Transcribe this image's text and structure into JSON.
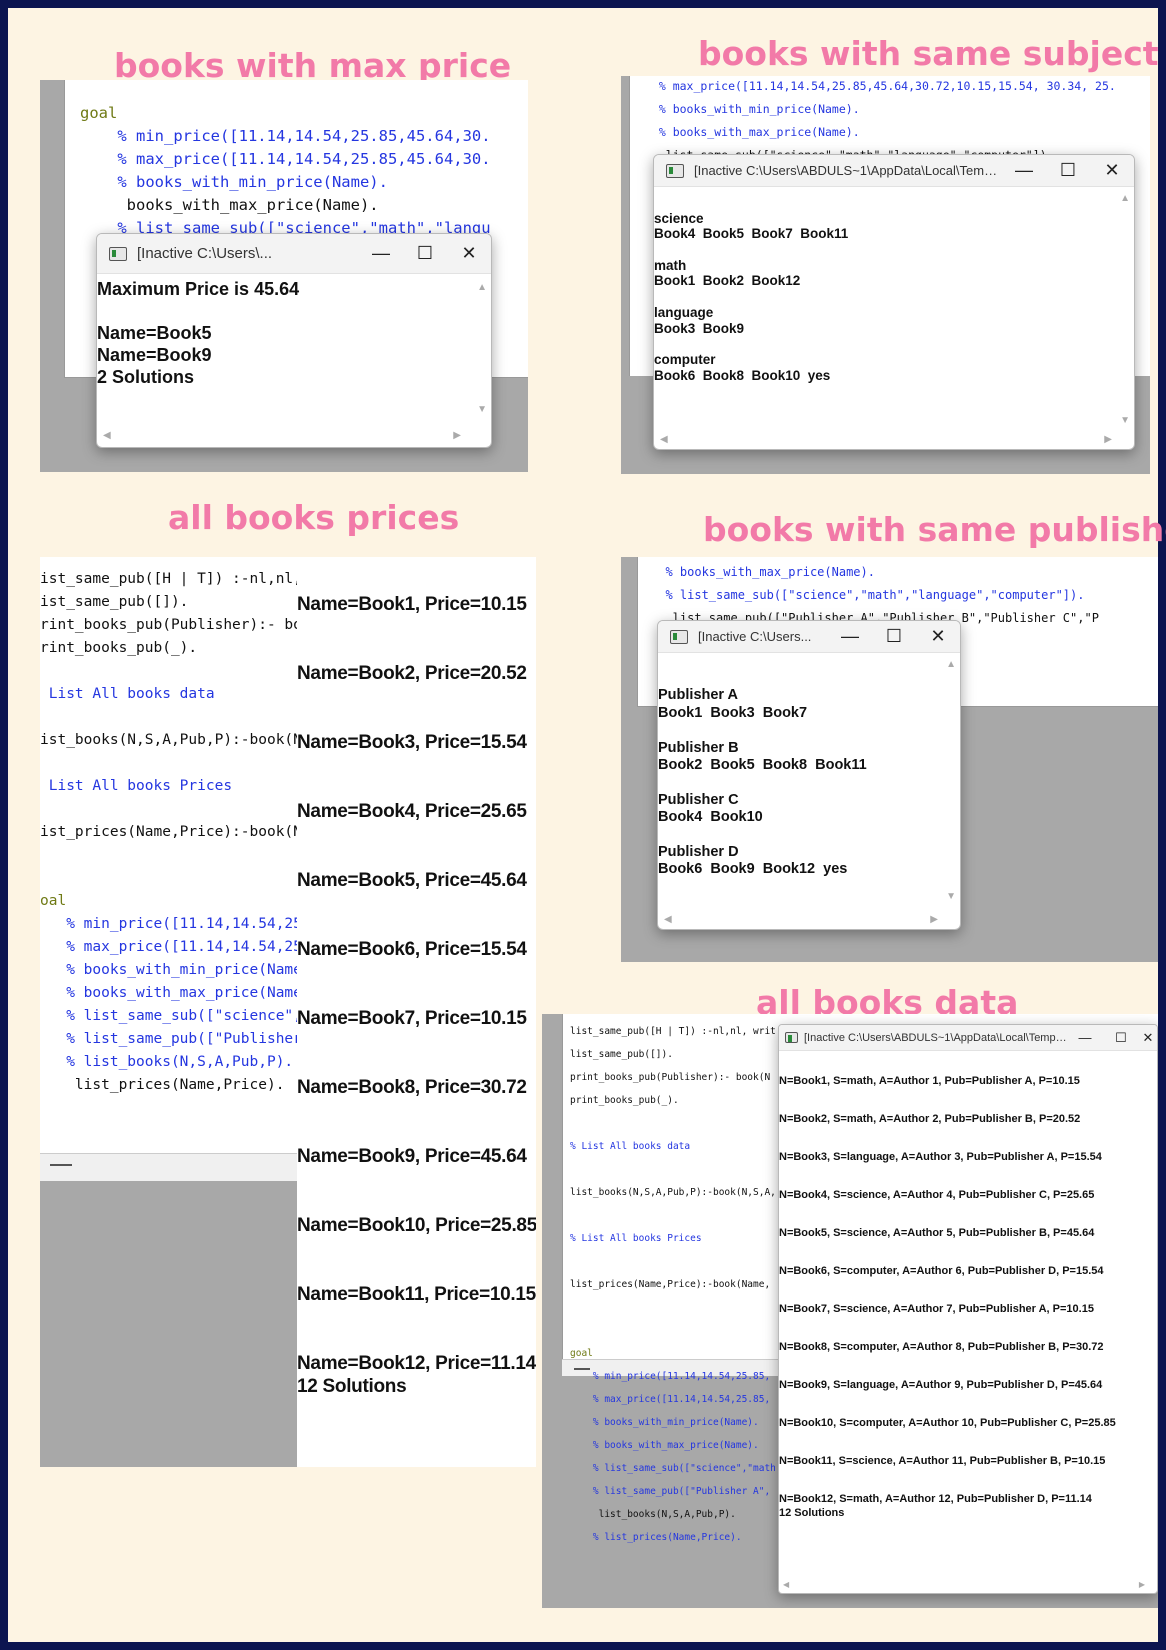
{
  "headings": {
    "max_price": "books with max price",
    "same_subject": "books with same subject",
    "all_prices": "all books prices",
    "same_publisher": "books with same publisher",
    "all_data": "all books data"
  },
  "panel1": {
    "code": [
      {
        "text": "goal",
        "cls": "k"
      },
      {
        "text": "    % min_price([11.14,14.54,25.85,45.64,30.",
        "cls": ""
      },
      {
        "text": "    % max_price([11.14,14.54,25.85,45.64,30.",
        "cls": ""
      },
      {
        "text": "    % books_with_min_price(Name).",
        "cls": ""
      },
      {
        "text": "     books_with_max_price(Name).",
        "cls": "b"
      },
      {
        "text": "    % list_same_sub([\"science\",\"math\",\"langu",
        "cls": ""
      }
    ],
    "window": {
      "title": "[Inactive C:\\Users\\...",
      "lines": [
        "Maximum Price is 45.64",
        "",
        "Name=Book5",
        "Name=Book9",
        "2 Solutions"
      ]
    }
  },
  "panel2": {
    "code": [
      {
        "text": "  % max_price([11.14,14.54,25.85,45.64,30.72,10.15,15.54, 30.34, 25.",
        "cls": ""
      },
      {
        "text": "  % books_with_min_price(Name).",
        "cls": ""
      },
      {
        "text": "  % books_with_max_price(Name).",
        "cls": ""
      },
      {
        "text": "   list_same_sub([\"science\",\"math\",\"language\",\"computer\"]).",
        "cls": "b"
      }
    ],
    "window": {
      "title": "[Inactive C:\\Users\\ABDULS~1\\AppData\\Local\\Temp\\g...",
      "lines": [
        "",
        "science",
        "Book4  Book5  Book7  Book11",
        "",
        "math",
        "Book1  Book2  Book12",
        "",
        "language",
        "Book3  Book9",
        "",
        "computer",
        "Book6  Book8  Book10  yes"
      ]
    }
  },
  "panel3": {
    "code": [
      {
        "text": "ist_same_pub([H | T]) :-nl,nl,",
        "cls": "b"
      },
      {
        "text": "ist_same_pub([]).",
        "cls": "b"
      },
      {
        "text": "rint_books_pub(Publisher):- bo",
        "cls": "b"
      },
      {
        "text": "rint_books_pub(_).",
        "cls": "b"
      },
      {
        "text": "",
        "cls": ""
      },
      {
        "text": " List All books data",
        "cls": ""
      },
      {
        "text": "",
        "cls": ""
      },
      {
        "text": "ist_books(N,S,A,Pub,P):-book(N",
        "cls": "b"
      },
      {
        "text": "",
        "cls": ""
      },
      {
        "text": " List All books Prices",
        "cls": ""
      },
      {
        "text": "",
        "cls": ""
      },
      {
        "text": "ist_prices(Name,Price):-book(N",
        "cls": "b"
      },
      {
        "text": "",
        "cls": ""
      },
      {
        "text": "",
        "cls": ""
      },
      {
        "text": "oal",
        "cls": "k"
      },
      {
        "text": "   % min_price([11.14,14.54,25",
        "cls": ""
      },
      {
        "text": "   % max_price([11.14,14.54,25",
        "cls": ""
      },
      {
        "text": "   % books_with_min_price(Name",
        "cls": ""
      },
      {
        "text": "   % books_with_max_price(Name",
        "cls": ""
      },
      {
        "text": "   % list_same_sub([\"science\",",
        "cls": ""
      },
      {
        "text": "   % list_same_pub([\"Publisher",
        "cls": ""
      },
      {
        "text": "   % list_books(N,S,A,Pub,P).",
        "cls": ""
      },
      {
        "text": "    list_prices(Name,Price).",
        "cls": "b"
      }
    ],
    "output": [
      "Name=Book1, Price=10.15",
      "Name=Book2, Price=20.52",
      "Name=Book3, Price=15.54",
      "Name=Book4, Price=25.65",
      "Name=Book5, Price=45.64",
      "Name=Book6, Price=15.54",
      "Name=Book7, Price=10.15",
      "Name=Book8, Price=30.72",
      "Name=Book9, Price=45.64",
      "Name=Book10, Price=25.85",
      "Name=Book11, Price=10.15",
      "Name=Book12, Price=11.14"
    ],
    "solutions": "12 Solutions"
  },
  "panel4": {
    "code": [
      {
        "text": "  % books_with_max_price(Name).",
        "cls": ""
      },
      {
        "text": "  % list_same_sub([\"science\",\"math\",\"language\",\"computer\"]).",
        "cls": ""
      },
      {
        "text": "   list_same_pub([\"Publisher A\",\"Publisher B\",\"Publisher C\",\"P",
        "cls": "b"
      }
    ],
    "window": {
      "title": "[Inactive C:\\Users...",
      "lines": [
        "",
        "Publisher A",
        "Book1  Book3  Book7",
        "",
        "Publisher B",
        "Book2  Book5  Book8  Book11",
        "",
        "Publisher C",
        "Book4  Book10",
        "",
        "Publisher D",
        "Book6  Book9  Book12  yes"
      ]
    }
  },
  "panel5": {
    "code": [
      {
        "text": "list_same_pub([H | T]) :-nl,nl, writ",
        "cls": "b"
      },
      {
        "text": "list_same_pub([]).",
        "cls": "b"
      },
      {
        "text": "print_books_pub(Publisher):- book(N",
        "cls": "b"
      },
      {
        "text": "print_books_pub(_).",
        "cls": "b"
      },
      {
        "text": "",
        "cls": ""
      },
      {
        "text": "% List All books data",
        "cls": ""
      },
      {
        "text": "",
        "cls": ""
      },
      {
        "text": "list_books(N,S,A,Pub,P):-book(N,S,A,",
        "cls": "b"
      },
      {
        "text": "",
        "cls": ""
      },
      {
        "text": "% List All books Prices",
        "cls": ""
      },
      {
        "text": "",
        "cls": ""
      },
      {
        "text": "list_prices(Name,Price):-book(Name,",
        "cls": "b"
      },
      {
        "text": "",
        "cls": ""
      },
      {
        "text": "",
        "cls": ""
      },
      {
        "text": "goal",
        "cls": "k"
      },
      {
        "text": "    % min_price([11.14,14.54,25.85,",
        "cls": ""
      },
      {
        "text": "    % max_price([11.14,14.54,25.85,",
        "cls": ""
      },
      {
        "text": "    % books_with_min_price(Name).",
        "cls": ""
      },
      {
        "text": "    % books_with_max_price(Name).",
        "cls": ""
      },
      {
        "text": "    % list_same_sub([\"science\",\"math",
        "cls": ""
      },
      {
        "text": "    % list_same_pub([\"Publisher A\",",
        "cls": ""
      },
      {
        "text": "     list_books(N,S,A,Pub,P).",
        "cls": "b"
      },
      {
        "text": "    % list_prices(Name,Price).",
        "cls": ""
      }
    ],
    "window": {
      "title": "[Inactive C:\\Users\\ABDULS~1\\AppData\\Local\\Temp\\goa...",
      "lines": [
        "N=Book1, S=math, A=Author 1, Pub=Publisher A, P=10.15",
        "N=Book2, S=math, A=Author 2, Pub=Publisher B, P=20.52",
        "N=Book3, S=language, A=Author 3, Pub=Publisher A, P=15.54",
        "N=Book4, S=science, A=Author 4, Pub=Publisher C, P=25.65",
        "N=Book5, S=science, A=Author 5, Pub=Publisher B, P=45.64",
        "N=Book6, S=computer, A=Author 6, Pub=Publisher D, P=15.54",
        "N=Book7, S=science, A=Author 7, Pub=Publisher A, P=10.15",
        "N=Book8, S=computer, A=Author 8, Pub=Publisher B, P=30.72",
        "N=Book9, S=language, A=Author 9, Pub=Publisher D, P=45.64",
        "N=Book10, S=computer, A=Author 10, Pub=Publisher C, P=25.85",
        "N=Book11, S=science, A=Author 11, Pub=Publisher B, P=10.15",
        "N=Book12, S=math, A=Author 12, Pub=Publisher D, P=11.14"
      ],
      "solutions": "12 Solutions"
    }
  },
  "window_controls": {
    "minimize": "—",
    "maximize": "☐",
    "close": "✕"
  }
}
